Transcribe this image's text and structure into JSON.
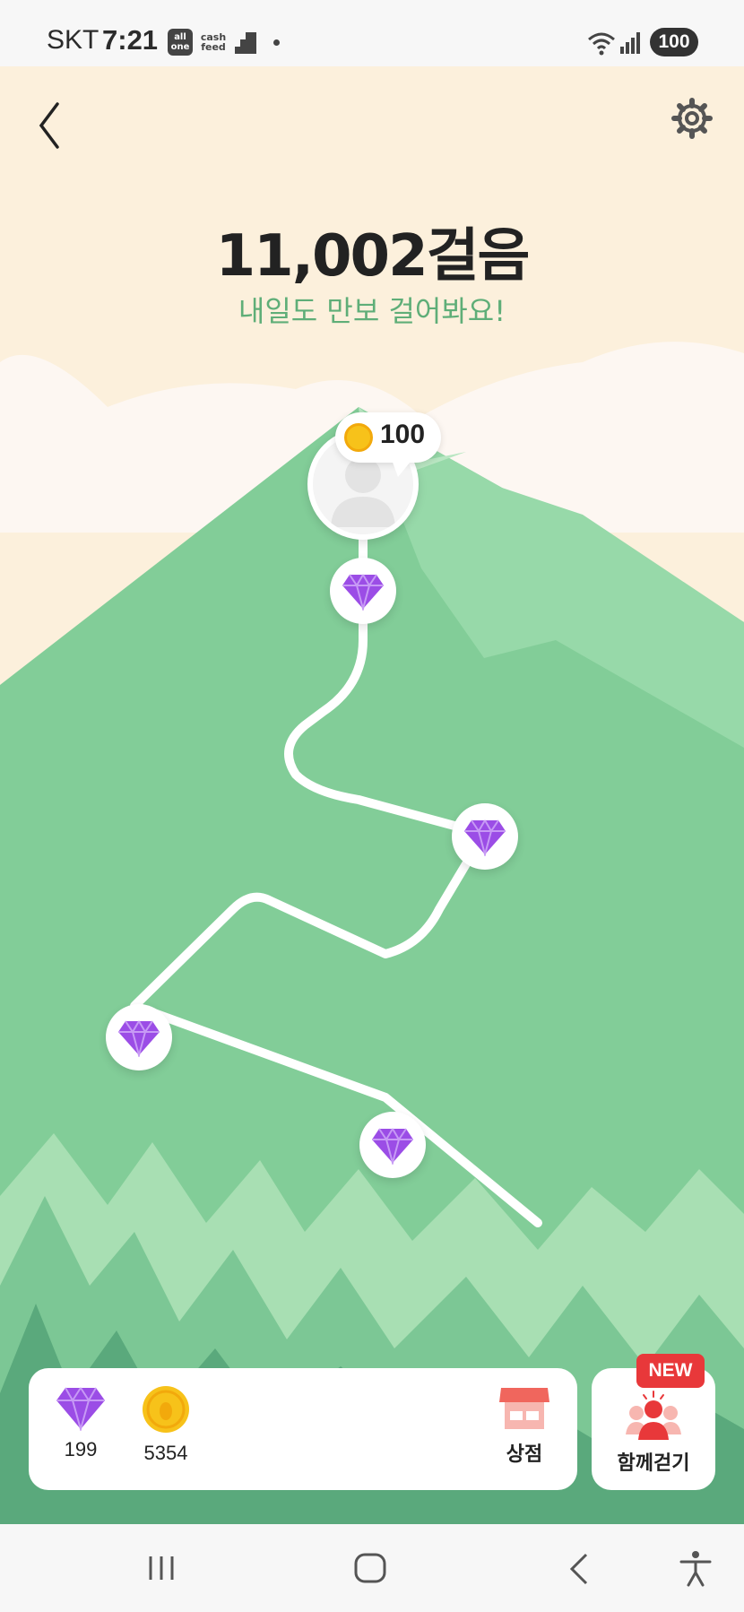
{
  "status_bar": {
    "carrier": "SKT",
    "time": "7:21",
    "app_icons": [
      "all one",
      "cash feed"
    ],
    "battery": "100"
  },
  "header": {
    "back_icon": "chevron-left-icon",
    "settings_icon": "gear-icon"
  },
  "hero": {
    "steps": "11,002걸음",
    "slogan": "내일도 만보 걸어봐요!"
  },
  "avatar": {
    "coin_count": "100"
  },
  "path": {
    "gems": [
      "gem-1",
      "gem-2",
      "gem-3",
      "gem-4"
    ]
  },
  "inventory": {
    "gems": "199",
    "coins": "5354",
    "shop_label": "상점"
  },
  "together": {
    "label": "함께걷기",
    "badge": "NEW"
  },
  "colors": {
    "mountain": "#82cd98",
    "sky": "#fcf0dc",
    "slogan": "#5fae78",
    "gem": "#9b4de6",
    "coin": "#f7c21a",
    "badge": "#e8383a"
  }
}
